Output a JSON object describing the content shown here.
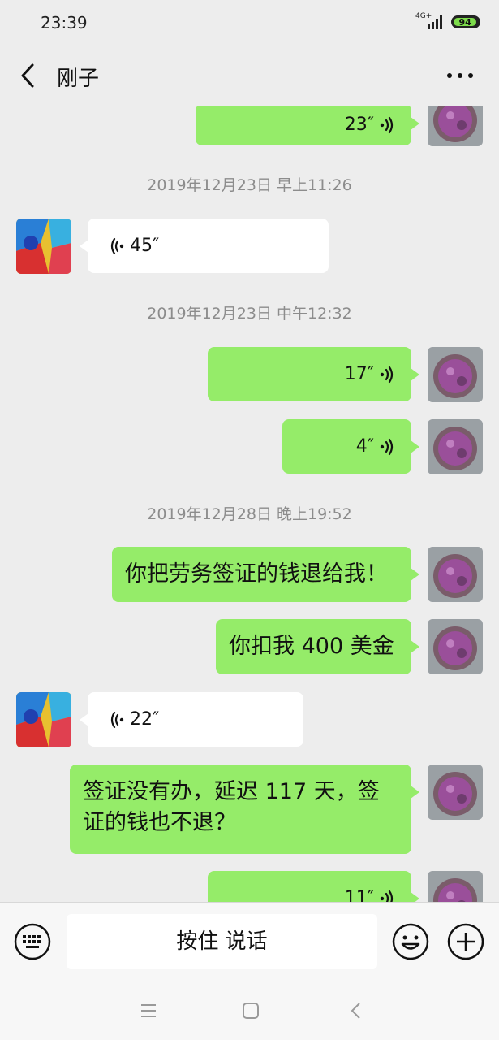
{
  "status_bar": {
    "time": "23:39",
    "network": "4G+",
    "battery": "94",
    "battery_level_percent": 94
  },
  "header": {
    "title": "刚子",
    "back_icon": "chevron-left-icon",
    "more_icon": "more-dots-icon"
  },
  "messages": [
    {
      "type": "voice",
      "side": "right",
      "duration": "23″"
    },
    {
      "type": "timestamp",
      "text": "2019年12月23日 早上11:26"
    },
    {
      "type": "voice",
      "side": "left",
      "duration": "45″"
    },
    {
      "type": "timestamp",
      "text": "2019年12月23日 中午12:32"
    },
    {
      "type": "voice",
      "side": "right",
      "duration": "17″"
    },
    {
      "type": "voice",
      "side": "right",
      "duration": "4″"
    },
    {
      "type": "timestamp",
      "text": "2019年12月28日 晚上19:52"
    },
    {
      "type": "text",
      "side": "right",
      "text": "你把劳务签证的钱退给我！"
    },
    {
      "type": "text",
      "side": "right",
      "text": "你扣我 400 美金"
    },
    {
      "type": "voice",
      "side": "left",
      "duration": "22″"
    },
    {
      "type": "text",
      "side": "right",
      "text": "签证没有办，延迟 117 天，签证的钱也不退？"
    },
    {
      "type": "voice",
      "side": "right",
      "duration": "11″"
    }
  ],
  "input_bar": {
    "hold_to_talk_label": "按住 说话",
    "keyboard_icon": "keyboard-icon",
    "emoji_icon": "emoji-icon",
    "plus_icon": "plus-icon"
  },
  "nav_bar": {
    "icons": [
      "menu-icon",
      "home-square-icon",
      "back-chevron-icon"
    ]
  },
  "colors": {
    "background": "#ededed",
    "sent_bubble": "#95ec69",
    "received_bubble": "#ffffff",
    "timestamp_text": "#8c8c8c",
    "battery": "#7ddc4b"
  }
}
